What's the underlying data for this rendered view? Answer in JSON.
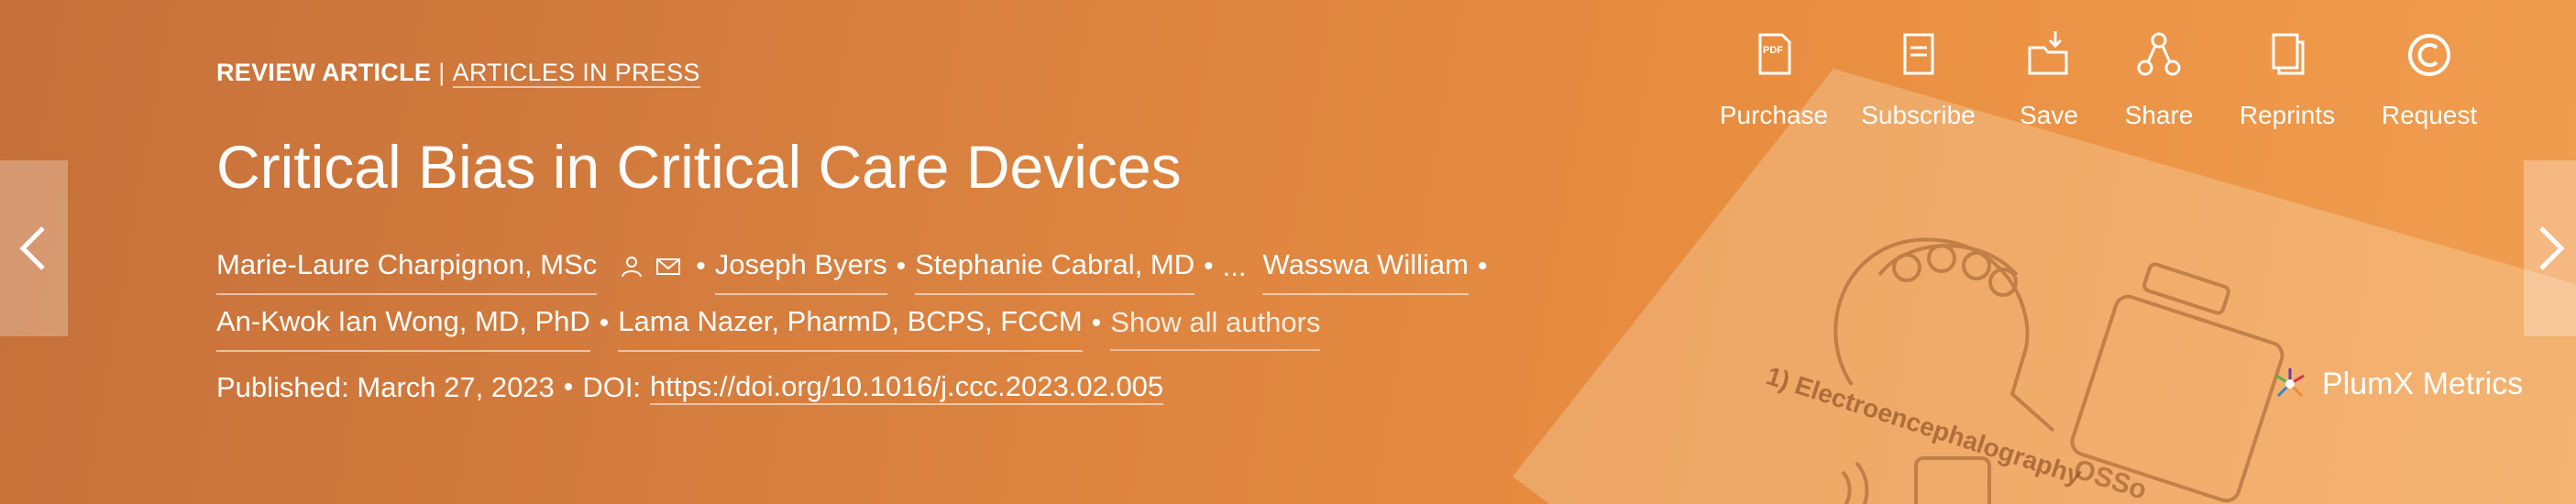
{
  "article": {
    "type": "REVIEW ARTICLE",
    "type_separator": "|",
    "issue_status": "ARTICLES IN PRESS",
    "title": "Critical Bias in Critical Care Devices"
  },
  "authors_line1": [
    {
      "name": "Marie-Laure Charpignon, MSc"
    },
    {
      "name": "Joseph Byers"
    },
    {
      "name": "Stephanie Cabral, MD"
    },
    {
      "name": "Wasswa William"
    }
  ],
  "authors_line2": [
    {
      "name": "An-Kwok Ian Wong, MD, PhD"
    },
    {
      "name": "Lama Nazer, PharmD, BCPS, FCCM"
    }
  ],
  "authors_ellipsis": "...",
  "bullet": "•",
  "show_all_authors": "Show all authors",
  "publication": {
    "published_label": "Published: March 27, 2023",
    "doi_label": "DOI:",
    "doi_url": "https://doi.org/10.1016/j.ccc.2023.02.005"
  },
  "toolbar": [
    {
      "label": "Purchase",
      "icon": "pdf-icon"
    },
    {
      "label": "Subscribe",
      "icon": "document-icon"
    },
    {
      "label": "Save",
      "icon": "folder-save-icon"
    },
    {
      "label": "Share",
      "icon": "share-icon"
    },
    {
      "label": "Reprints",
      "icon": "copy-icon"
    },
    {
      "label": "Request",
      "icon": "copyright-icon"
    }
  ],
  "plumx": {
    "label": "PlumX Metrics"
  },
  "illustration": {
    "caption": "1) Electroencephalography",
    "caption2": "OSSo"
  },
  "colors": {
    "bg_start": "#c6703a",
    "bg_end": "#f19e50",
    "text": "#ffffff"
  }
}
